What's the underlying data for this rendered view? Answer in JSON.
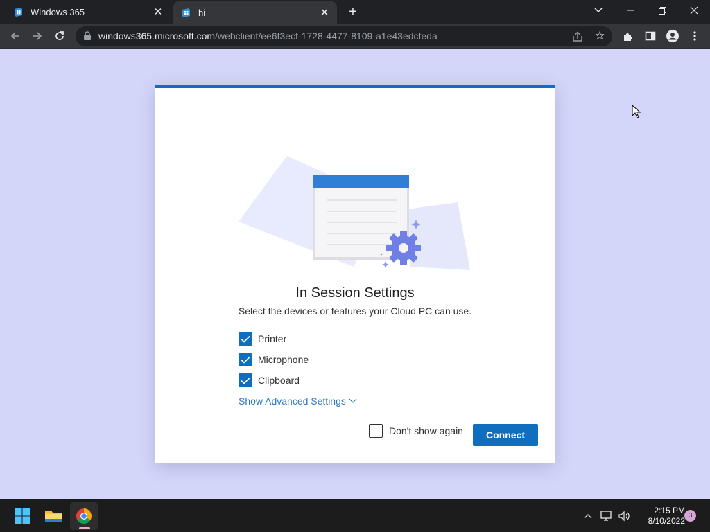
{
  "browser": {
    "tabs": [
      {
        "title": "Windows 365",
        "icon": "windows365-icon"
      },
      {
        "title": "hi",
        "icon": "windows365-icon"
      }
    ],
    "url_host": "windows365.microsoft.com",
    "url_path": "/webclient/ee6f3ecf-1728-4477-8109-a1e43edcfeda"
  },
  "dialog": {
    "title": "In Session Settings",
    "subtitle": "Select the devices or features your Cloud PC can use.",
    "options": [
      {
        "label": "Printer",
        "checked": true
      },
      {
        "label": "Microphone",
        "checked": true
      },
      {
        "label": "Clipboard",
        "checked": true
      }
    ],
    "advanced_link": "Show Advanced Settings",
    "dont_show_label": "Don't show again",
    "dont_show_checked": false,
    "connect_label": "Connect",
    "accent": "#106ebe"
  },
  "taskbar": {
    "time": "2:15 PM",
    "date": "8/10/2022",
    "notifications": "3"
  }
}
